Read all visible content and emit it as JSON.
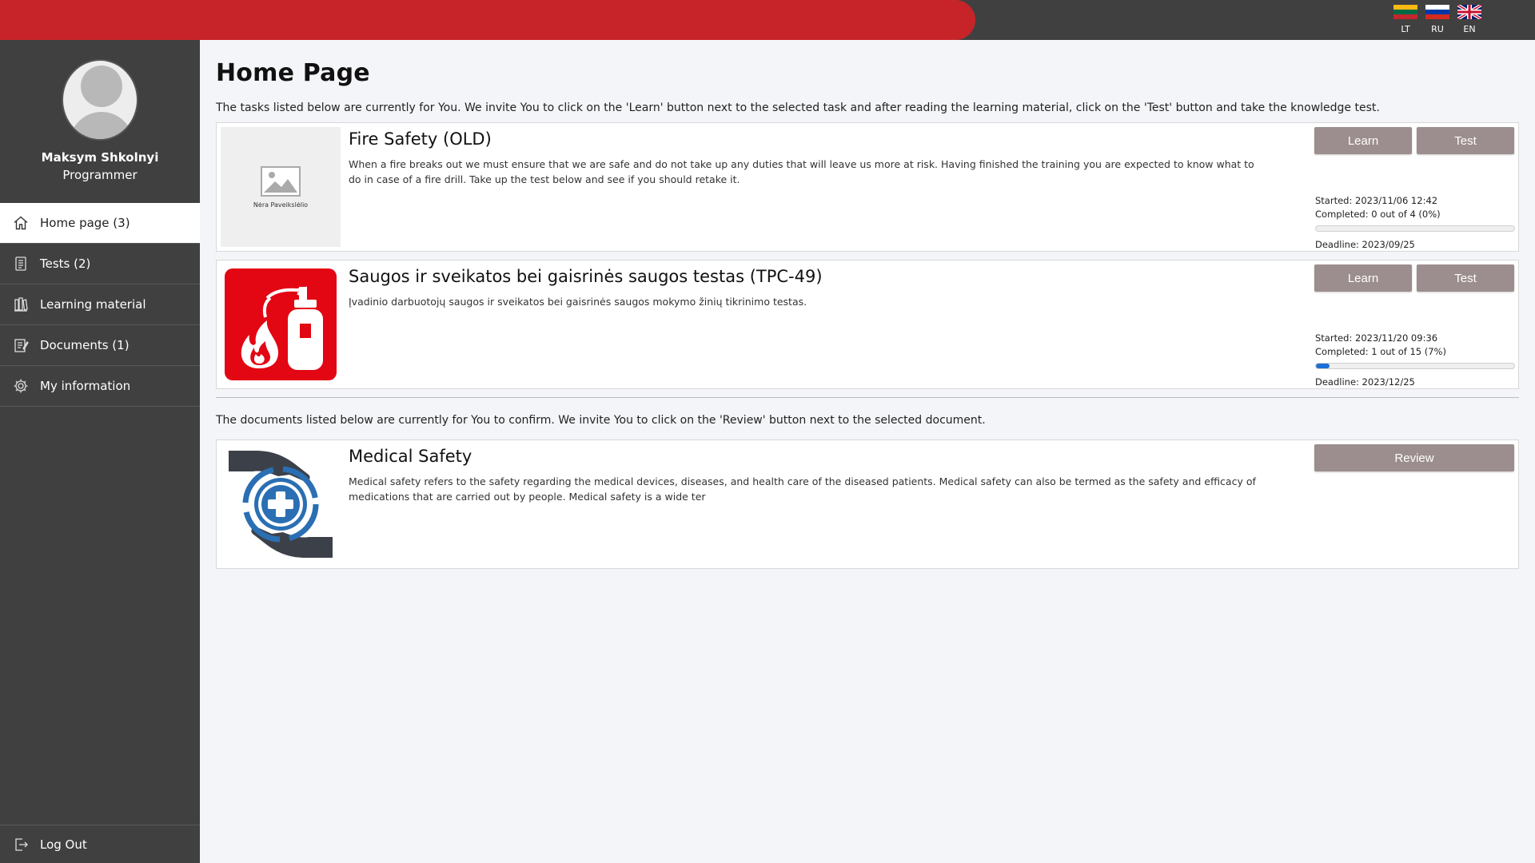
{
  "languages": [
    {
      "code": "LT",
      "flag": "lt-flag"
    },
    {
      "code": "RU",
      "flag": "ru-flag"
    },
    {
      "code": "EN",
      "flag": "uk-flag"
    }
  ],
  "user": {
    "name": "Maksym Shkolnyi",
    "role": "Programmer"
  },
  "nav": {
    "items": [
      {
        "label": "Home page (3)",
        "icon": "home-icon",
        "active": true
      },
      {
        "label": "Tests (2)",
        "icon": "tests-icon"
      },
      {
        "label": "Learning material",
        "icon": "books-icon"
      },
      {
        "label": "Documents (1)",
        "icon": "documents-icon"
      },
      {
        "label": "My information",
        "icon": "gear-icon"
      }
    ],
    "logout": "Log Out"
  },
  "page": {
    "title": "Home Page",
    "tasks_intro": "The tasks listed below are currently for You. We invite You to click on the 'Learn' button next to the selected task and after reading the learning material, click on the 'Test' button and take the knowledge test.",
    "docs_intro": "The documents listed below are currently for You to confirm. We invite You to click on the 'Review' button next to the selected document."
  },
  "tasks": [
    {
      "title": "Fire Safety (OLD)",
      "description": "When a fire breaks out we must ensure that we are safe and do not take up any duties that will leave us more at risk. Having finished the training you are expected to know what to do in case of a fire drill. Take up the test below and see if you should retake it.",
      "image_label": "Nėra Paveikslėlio",
      "learn": "Learn",
      "test": "Test",
      "started": "Started: 2023/11/06 12:42",
      "completed": "Completed: 0 out of 4 (0%)",
      "progress": 0,
      "deadline": "Deadline: 2023/09/25"
    },
    {
      "title": "Saugos ir sveikatos bei gaisrinės saugos testas (TPC-49)",
      "description": "Įvadinio darbuotojų saugos ir sveikatos bei gaisrinės saugos mokymo žinių tikrinimo testas.",
      "image": "fire-extinguisher-icon",
      "learn": "Learn",
      "test": "Test",
      "started": "Started: 2023/11/20 09:36",
      "completed": "Completed: 1 out of 15 (7%)",
      "progress": 7,
      "deadline": "Deadline: 2023/12/25"
    }
  ],
  "documents": [
    {
      "title": "Medical Safety",
      "description": "Medical safety refers to the safety regarding the medical devices, diseases, and health care of the diseased patients. Medical safety can also be termed as the safety and efficacy of medications that are carried out by people. Medical safety is a wide ter",
      "image": "medical-hands-icon",
      "review": "Review"
    }
  ],
  "colors": {
    "brand_red": "#c7242a",
    "sidebar": "#404040",
    "button": "#9c8e8e",
    "progress": "#1c6fd6"
  }
}
